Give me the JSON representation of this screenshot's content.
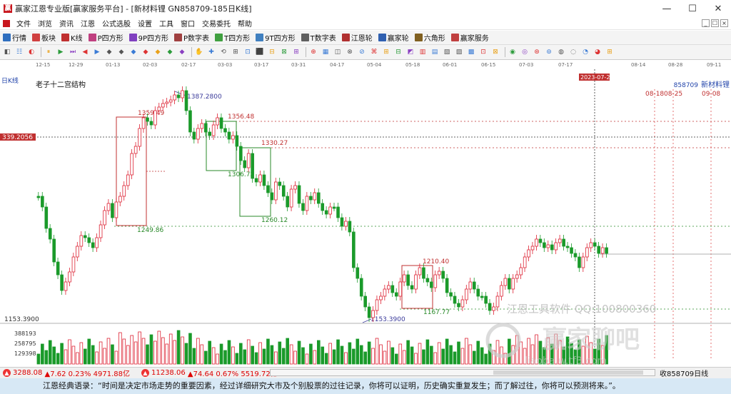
{
  "window": {
    "title": "赢家江恩专业版[赢家服务平台] - [新材料锂 GN858709-185日K线]",
    "minimize": "—",
    "maximize": "☐",
    "close": "✕"
  },
  "menu": [
    "文件",
    "浏览",
    "资讯",
    "江恩",
    "公式选股",
    "设置",
    "工具",
    "窗口",
    "交易委托",
    "帮助"
  ],
  "mdi_controls": [
    "_",
    "☐",
    "×"
  ],
  "toolbar1": [
    {
      "label": "行情",
      "icon": "grid-icon",
      "color": "#2f6fbf"
    },
    {
      "label": "板块",
      "icon": "blocks-icon",
      "color": "#d04040"
    },
    {
      "label": "K线",
      "icon": "kline-icon",
      "color": "#c03030"
    },
    {
      "label": "P四方形",
      "icon": "p-square-icon",
      "color": "#c04080"
    },
    {
      "label": "9P四方形",
      "icon": "9p-square-icon",
      "color": "#8040c0"
    },
    {
      "label": "P数字表",
      "icon": "p-table-icon",
      "color": "#a04040"
    },
    {
      "label": "T四方形",
      "icon": "t-square-icon",
      "color": "#40a040"
    },
    {
      "label": "9T四方形",
      "icon": "9t-square-icon",
      "color": "#4080c0"
    },
    {
      "label": "T数字表",
      "icon": "t-table-icon",
      "color": "#606060"
    },
    {
      "label": "江恩轮",
      "icon": "gann-wheel-icon",
      "color": "#b03030"
    },
    {
      "label": "赢家轮",
      "icon": "winner-wheel-icon",
      "color": "#3060b0"
    },
    {
      "label": "六角形",
      "icon": "hexagon-icon",
      "color": "#806020"
    },
    {
      "label": "赢家服务",
      "icon": "service-icon",
      "color": "#c04040"
    }
  ],
  "toolbar2_colors": [
    "#555",
    "#3a7bd5",
    "#d33",
    "#e9a11a",
    "#2b9b3a",
    "#8a3fc1",
    "#d33",
    "#3a7bd5",
    "#555"
  ],
  "chart": {
    "indicator_label": "日K线",
    "study_label": "老子十二宫结构",
    "code": "858709",
    "name": "新材料锂",
    "crosshair_price": "339.2056",
    "crosshair_date": "2023-07-27",
    "future_dates": [
      "08-18",
      "08-25",
      "09-08"
    ],
    "bottom_axis_label": "1153.3900",
    "date_ticks": [
      "12-15",
      "12-29",
      "01-13",
      "02-03",
      "02-17",
      "03-03",
      "03-17",
      "03-31",
      "04-17",
      "05-04",
      "05-18",
      "06-01",
      "06-15",
      "07-03",
      "07-17",
      "2023-07-27",
      "08-14",
      "08-28",
      "09-11"
    ],
    "annotations": [
      {
        "text": "1387.2800",
        "color": "#3a3a9a"
      },
      {
        "text": "1359.49",
        "color": "#c03030"
      },
      {
        "text": "1356.48",
        "color": "#c03030"
      },
      {
        "text": "1330.27",
        "color": "#c03030"
      },
      {
        "text": "1306.72",
        "color": "#2a8a2a"
      },
      {
        "text": "1260.12",
        "color": "#2a8a2a"
      },
      {
        "text": "1249.86",
        "color": "#2a8a2a"
      },
      {
        "text": "1210.40",
        "color": "#c03030"
      },
      {
        "text": "1167.77",
        "color": "#2a8a2a"
      },
      {
        "text": "1153.3900",
        "color": "#3a3a9a"
      }
    ],
    "volume_ticks": [
      "388193",
      "258795",
      "129398"
    ],
    "watermark_1": "江恩工具软件 QQ:100800360",
    "watermark_2": "赢家聊吧",
    "watermark_3": "liaoba.w.tf3.com"
  },
  "statusbar": {
    "index1": "3288.08",
    "index1_change": "▲7.62 0.23% 4971.88亿",
    "index2": "11238.06",
    "index2_change": "▲74.64 0.67% 5519.72亿",
    "right_label": "收858709日线"
  },
  "quote": "江恩经典语录：“时间是决定市场走势的重要因素，经过详细研究大市及个别股票的过往记录，你将可以证明，历史确实重复发生；而了解过往，你将可以预测将来。”。"
}
